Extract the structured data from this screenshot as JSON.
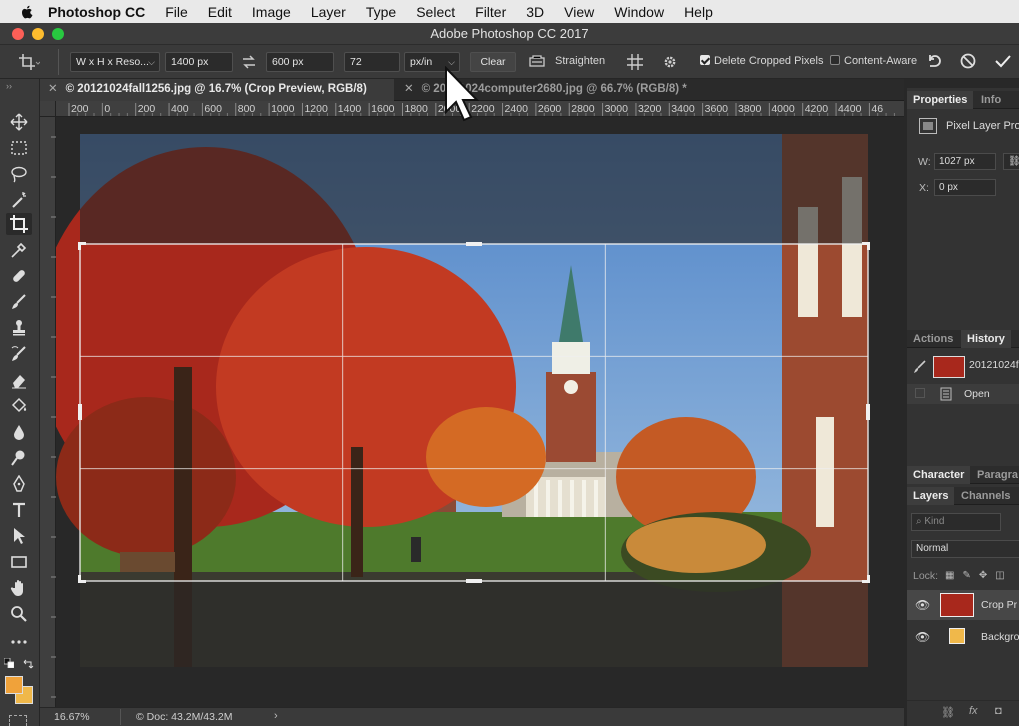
{
  "menubar": {
    "app": "Photoshop CC",
    "items": [
      "File",
      "Edit",
      "Image",
      "Layer",
      "Type",
      "Select",
      "Filter",
      "3D",
      "View",
      "Window",
      "Help"
    ]
  },
  "window": {
    "title": "Adobe Photoshop CC 2017"
  },
  "options": {
    "ratio_select": "W x H x Reso...",
    "width": "1400 px",
    "height": "600 px",
    "resolution": "72",
    "units": "px/in",
    "clear": "Clear",
    "straighten": "Straighten",
    "delete_cropped": "Delete Cropped Pixels",
    "delete_cropped_checked": true,
    "content_aware": "Content-Aware",
    "content_aware_checked": false
  },
  "tabs": [
    {
      "label": "© 20121024fall1256.jpg @ 16.7% (Crop Preview, RGB/8)",
      "active": true
    },
    {
      "label": "© 20121024computer2680.jpg @ 66.7% (RGB/8) *",
      "active": false
    }
  ],
  "ruler": {
    "labels": [
      "200",
      "0",
      "200",
      "400",
      "600",
      "800",
      "1000",
      "1200",
      "1400",
      "1600",
      "1800",
      "2000",
      "2200",
      "2400",
      "2600",
      "2800",
      "3000",
      "3200",
      "3400",
      "3600",
      "3800",
      "4000",
      "4200",
      "4400",
      "46"
    ]
  },
  "status": {
    "zoom": "16.67%",
    "doc": "Doc: 43.2M/43.2M"
  },
  "properties": {
    "tab_active": "Properties",
    "tab_other": "Info",
    "type": "Pixel Layer Pro",
    "w_label": "W:",
    "w_value": "1027 px",
    "x_label": "X:",
    "x_value": "0 px"
  },
  "history": {
    "tab_other": "Actions",
    "tab_active": "History",
    "snapshot": "20121024f",
    "items": [
      "Open"
    ]
  },
  "character": {
    "tab_active": "Character",
    "tab_other": "Paragra"
  },
  "layers": {
    "tab_active": "Layers",
    "tab_other": "Channels",
    "kind": "Kind",
    "blend": "Normal",
    "lock": "Lock:",
    "items": [
      "Crop Pr",
      "Backgro"
    ]
  },
  "colors": {
    "foreground": "#f0a23a",
    "background": "#f0b84a",
    "accent": "#3a78d6"
  }
}
